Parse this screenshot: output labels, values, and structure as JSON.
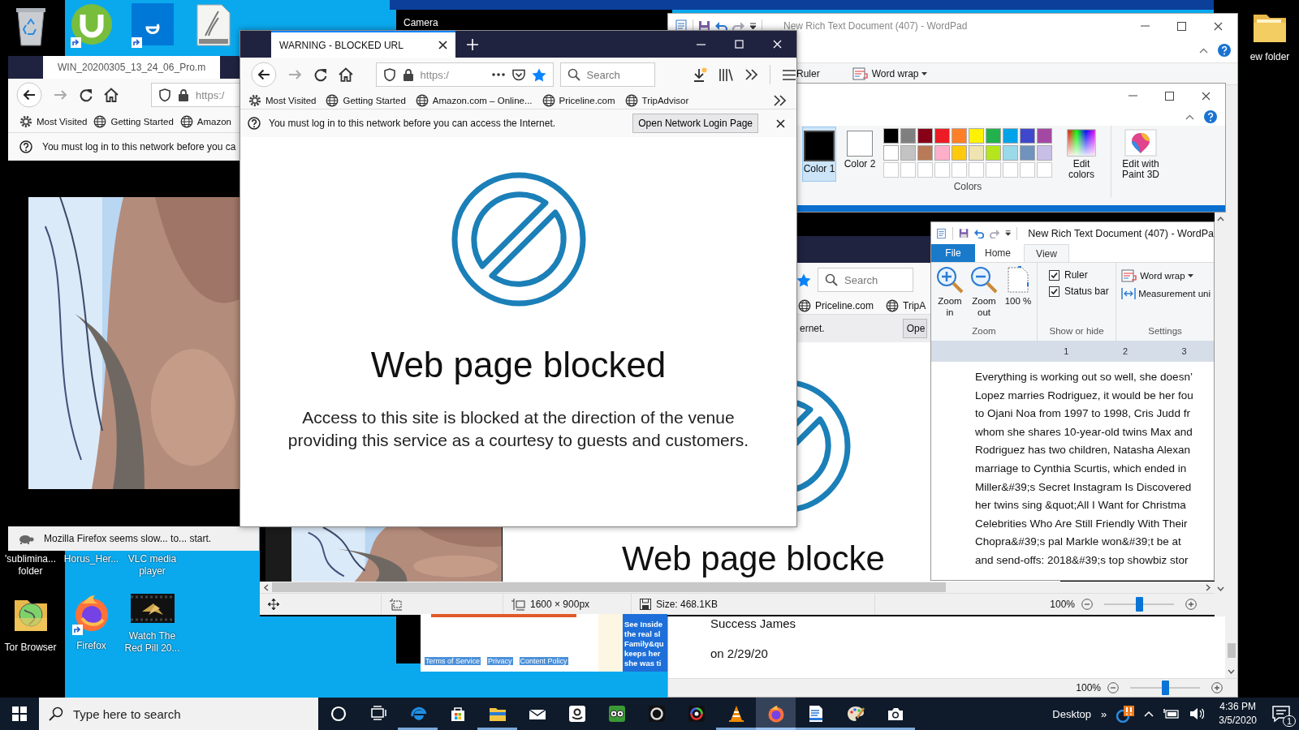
{
  "desktop": {
    "top_icons": [
      {
        "kind": "recycle_bin",
        "shortcut": false
      },
      {
        "kind": "utorrent",
        "shortcut": true
      },
      {
        "kind": "edge_tile",
        "shortcut": true
      },
      {
        "kind": "gradient",
        "shortcut": false
      }
    ],
    "corner_icons": [
      {
        "kind": "folder",
        "label": "ew folder",
        "shortcut": false
      }
    ],
    "bottom_icons": [
      {
        "kind": "hidden",
        "label": "'sublimina... folder",
        "shortcut": false
      },
      {
        "kind": "hidden",
        "label": "Horus_Her...",
        "shortcut": false
      },
      {
        "kind": "hidden",
        "label": "VLC media player",
        "shortcut": false
      },
      {
        "kind": "tor",
        "label": "Tor Browser",
        "shortcut": false
      },
      {
        "kind": "firefox",
        "label": "Firefox",
        "shortcut": true
      },
      {
        "kind": "video",
        "label": "Watch The Red Pill 20...",
        "shortcut": false
      }
    ]
  },
  "camera": {
    "title": "Camera"
  },
  "wordpad_back": {
    "title": "New Rich Text Document (407) - WordPad",
    "ribbon_items": [
      {
        "label": "Ruler",
        "kind": "text"
      },
      {
        "label": "Word wrap",
        "kind": "dropdown"
      }
    ],
    "lines": [
      "Success James",
      "on 2/29/20"
    ],
    "zoom": "100%",
    "zoom_slider": {
      "level": 0.5
    }
  },
  "paint": {
    "color_slots": [
      {
        "label": "Color 1",
        "selected": true,
        "color": "#000000"
      },
      {
        "label": "Color 2",
        "selected": false,
        "color": "#ffffff"
      }
    ],
    "palette": [
      {
        "color": "#000000"
      },
      {
        "color": "#7f7f7f"
      },
      {
        "color": "#880015"
      },
      {
        "color": "#ed1c24"
      },
      {
        "color": "#ff7f27"
      },
      {
        "color": "#fff200"
      },
      {
        "color": "#22b14c"
      },
      {
        "color": "#00a2e8"
      },
      {
        "color": "#3f48cc"
      },
      {
        "color": "#a349a4"
      },
      {
        "color": "#ffffff"
      },
      {
        "color": "#c3c3c3"
      },
      {
        "color": "#b97a57"
      },
      {
        "color": "#ffaec9"
      },
      {
        "color": "#ffc90e"
      },
      {
        "color": "#efe4b0"
      },
      {
        "color": "#b5e61d"
      },
      {
        "color": "#99d9ea"
      },
      {
        "color": "#7092be"
      },
      {
        "color": "#c8bfe7"
      }
    ],
    "group": "Colors",
    "tools": [
      {
        "label": "Edit colors",
        "kind": "edit_colors"
      },
      {
        "label": "Edit with Paint 3D",
        "kind": "paint3d"
      }
    ]
  },
  "viewer": {
    "screenshot": {
      "search_placeholder": "Search",
      "bookmarks": [
        "Priceline.com",
        "TripA"
      ],
      "notice": "ernet.",
      "button": "Ope",
      "heading": "Web page blocke"
    },
    "status": {
      "dimensions": "1600 × 900px",
      "size": "Size: 468.1KB",
      "zoom": "100%",
      "zoom_slider": {
        "level": 0.5
      }
    }
  },
  "web_fragment": {
    "links": [
      "Terms of Service",
      "Privacy",
      "Content Policy"
    ],
    "lines": [
      "See Inside",
      "the real sl",
      "Family&qu",
      "keeps her",
      "she was ti"
    ]
  },
  "back_browser": {
    "tab_title": "WIN_20200305_13_24_06_Pro.m",
    "url": "https:/",
    "bookmarks": [
      {
        "label": "Most Visited",
        "kind": "gear"
      },
      {
        "label": "Getting Started",
        "kind": "globe"
      },
      {
        "label": "Amazon",
        "kind": "globe"
      }
    ],
    "notice": "You must log in to this network before you ca",
    "slow_message": "Mozilla Firefox seems slow... to... start."
  },
  "wordpad_front": {
    "title": "New Rich Text Document (407) - WordPa",
    "tabs": [
      {
        "label": "File",
        "kind": "file",
        "selected": false
      },
      {
        "label": "Home",
        "kind": "tab",
        "selected": false
      },
      {
        "label": "View",
        "kind": "tab",
        "selected": true
      }
    ],
    "zoom_buttons": [
      {
        "label": "Zoom in",
        "kind": "zoom_in"
      },
      {
        "label": "Zoom out",
        "kind": "zoom_out"
      },
      {
        "label": "100 %",
        "kind": "page"
      }
    ],
    "show_or_hide": [
      {
        "label": "Ruler",
        "checked": true
      },
      {
        "label": "Status bar",
        "checked": true
      }
    ],
    "settings": [
      {
        "label": "Word wrap",
        "kind": "dropdown"
      },
      {
        "label": "Measurement uni",
        "kind": "measure"
      }
    ],
    "groups": [
      "Zoom",
      "Show or hide",
      "Settings"
    ],
    "ruler_marks": [
      "1",
      "2",
      "3"
    ],
    "lines": [
      "Everything is working out so well, she doesn’",
      "Lopez marries Rodriguez, it would be her fou",
      "to Ojani Noa from 1997 to 1998, Cris Judd fr",
      "whom she shares 10-year-old twins Max and",
      "Rodriguez has two children, Natasha Alexan",
      "marriage to Cynthia Scurtis, which ended in",
      "Miller&#39;s Secret Instagram Is Discovered",
      "her twins sing &quot;All I Want for Christma",
      "Celebrities Who Are Still Friendly With Their",
      "Chopra&#39;s pal Markle won&#39;t be at",
      "and send-offs: 2018&#39;s top showbiz stor"
    ]
  },
  "front_browser": {
    "tab_title": "WARNING - BLOCKED URL",
    "url": "https:/",
    "search_placeholder": "Search",
    "bookmarks": [
      {
        "label": "Most Visited",
        "kind": "gear"
      },
      {
        "label": "Getting Started",
        "kind": "globe"
      },
      {
        "label": "Amazon.com – Online...",
        "kind": "globe"
      },
      {
        "label": "Priceline.com",
        "kind": "globe"
      },
      {
        "label": "TripAdvisor",
        "kind": "globe"
      }
    ],
    "notice": "You must log in to this network before you can access the Internet.",
    "notice_button": "Open Network Login Page",
    "heading": "Web page blocked",
    "message": "Access to this site is blocked at the direction of the venue providing this service as a courtesy to guests and customers."
  },
  "taskbar": {
    "search_placeholder": "Type here to search",
    "apps": [
      {
        "kind": "cortana",
        "running": false,
        "selected": false
      },
      {
        "kind": "taskview",
        "running": false,
        "selected": false
      },
      {
        "kind": "edge",
        "running": true,
        "selected": false
      },
      {
        "kind": "store",
        "running": false,
        "selected": false
      },
      {
        "kind": "explorer",
        "running": true,
        "selected": false
      },
      {
        "kind": "mail",
        "running": false,
        "selected": false
      },
      {
        "kind": "amazon",
        "running": false,
        "selected": false
      },
      {
        "kind": "tripadvisor",
        "running": false,
        "selected": false
      },
      {
        "kind": "camring",
        "running": false,
        "selected": false
      },
      {
        "kind": "colorring",
        "running": false,
        "selected": false
      },
      {
        "kind": "vlc",
        "running": true,
        "selected": false
      },
      {
        "kind": "firefox",
        "running": true,
        "selected": true
      },
      {
        "kind": "wordpad",
        "running": true,
        "selected": false
      },
      {
        "kind": "paint",
        "running": true,
        "selected": false
      },
      {
        "kind": "camera",
        "running": true,
        "selected": false
      }
    ],
    "desktop_label": "Desktop",
    "overflow": "»",
    "time": "4:36 PM",
    "date": "3/5/2020",
    "notification_count": "1"
  }
}
